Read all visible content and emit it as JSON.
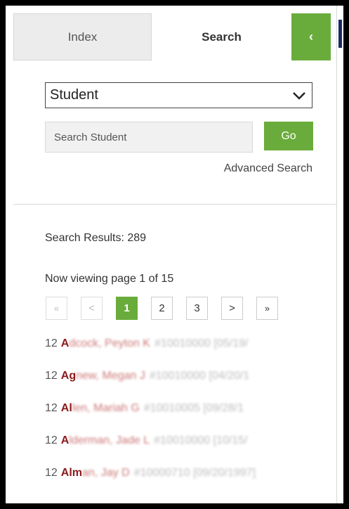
{
  "tabs": {
    "index": "Index",
    "search": "Search",
    "collapse": "‹"
  },
  "search": {
    "category": "Student",
    "placeholder": "Search Student",
    "go_label": "Go",
    "advanced_label": "Advanced Search"
  },
  "results": {
    "count_label": "Search Results: 289",
    "page_label": "Now viewing page 1 of 15"
  },
  "pager": {
    "first": "«",
    "prev": "<",
    "pages": [
      "1",
      "2",
      "3"
    ],
    "next": ">",
    "last": "»"
  },
  "students": [
    {
      "grade": "12",
      "name_visible": "A",
      "name_blurred": "dcock, Peyton K",
      "rest": "#10010000 [05/19/"
    },
    {
      "grade": "12",
      "name_visible": "Ag",
      "name_blurred": "new, Megan J",
      "rest": "#10010000 [04/20/1"
    },
    {
      "grade": "12",
      "name_visible": "Al",
      "name_blurred": "len, Mariah G",
      "rest": "#10010005 [09/28/1"
    },
    {
      "grade": "12",
      "name_visible": "A",
      "name_blurred": "lderman, Jade L",
      "rest": "#10010000 [10/15/"
    },
    {
      "grade": "12",
      "name_visible": "Alm",
      "name_blurred": "an, Jay D",
      "rest": "#10000710 [09/20/1997]"
    }
  ],
  "colors": {
    "accent_green": "#6aac3b",
    "name_red": "#8b1a1a"
  }
}
